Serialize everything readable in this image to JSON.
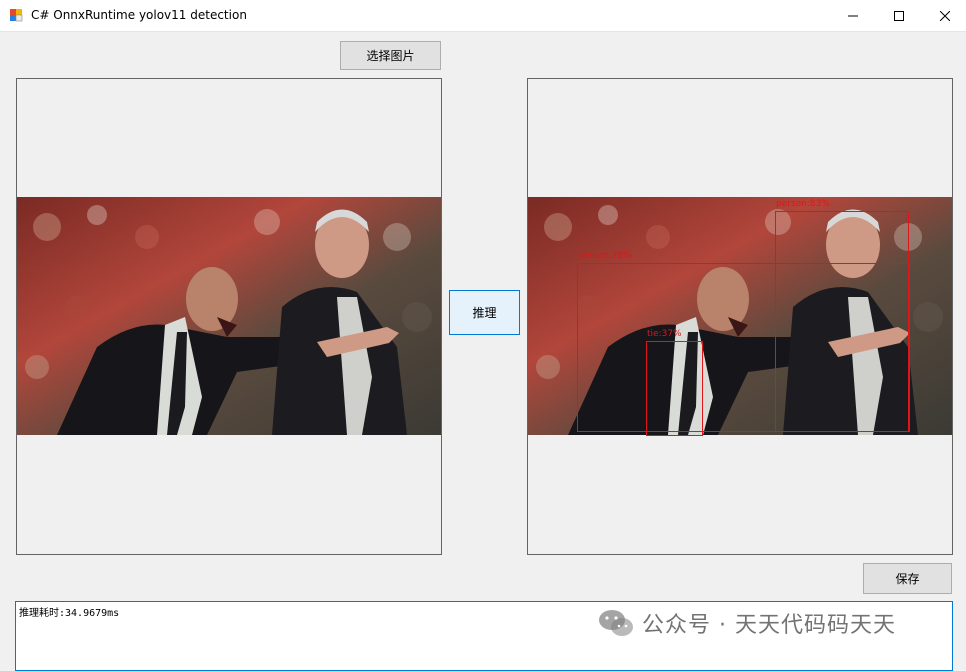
{
  "window": {
    "title": "C# OnnxRuntime yolov11 detection",
    "minimize_glyph": "—",
    "maximize_glyph": "☐",
    "close_glyph": "✕"
  },
  "buttons": {
    "select_image": "选择图片",
    "inference": "推理",
    "save": "保存"
  },
  "detections": [
    {
      "label": "person:83%"
    },
    {
      "label": "person:78%"
    },
    {
      "label": "tie:37%"
    }
  ],
  "output": {
    "text": "推理耗时:34.9679ms"
  },
  "watermark": {
    "text": "公众号 · 天天代码码天天"
  },
  "colors": {
    "detection_box": "#e0151a",
    "accent": "#0078d7"
  },
  "icons": [
    "app-icon",
    "minimize-icon",
    "maximize-icon",
    "close-icon",
    "wechat-icon"
  ]
}
